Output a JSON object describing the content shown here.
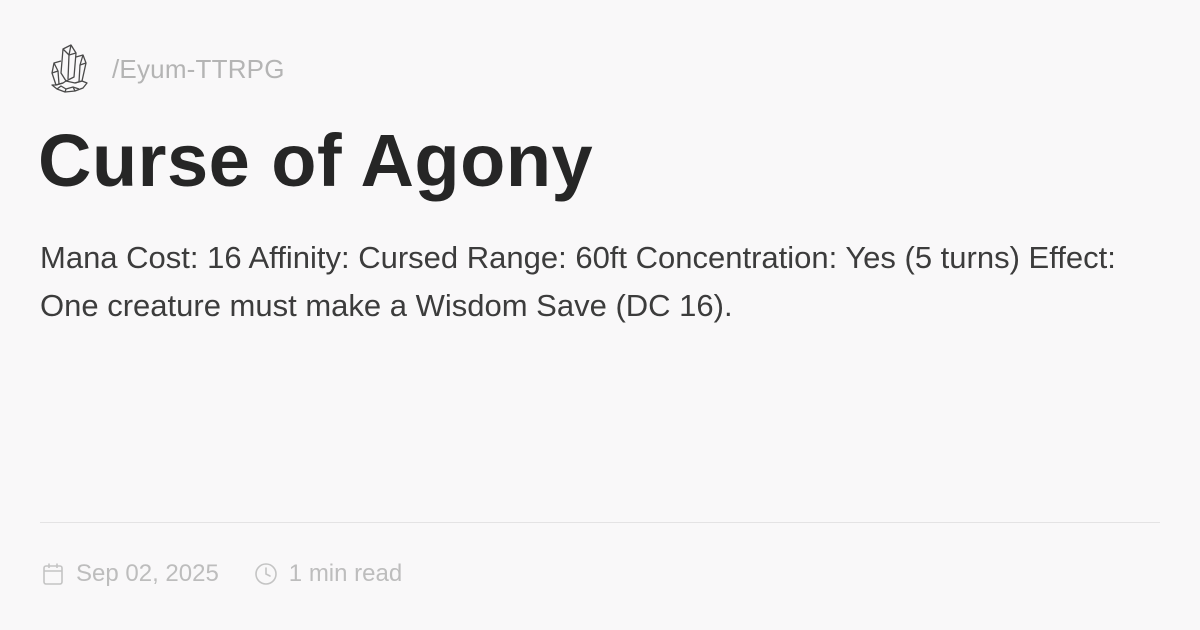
{
  "header": {
    "logo_icon": "crystal-cluster-icon",
    "site_path": "/Eyum-TTRPG"
  },
  "article": {
    "title": "Curse of Agony",
    "summary": "Mana Cost: 16 Affinity: Cursed Range: 60ft Concentration: Yes (5 turns) Effect: One creature must make a Wisdom Save (DC 16)."
  },
  "meta": {
    "date_icon": "calendar-icon",
    "date": "Sep 02, 2025",
    "read_time_icon": "clock-icon",
    "read_time": "1 min read"
  },
  "colors": {
    "background": "#f9f8f9",
    "title": "#262626",
    "body_text": "#3c3c3c",
    "muted_text": "#bdbdbd"
  }
}
